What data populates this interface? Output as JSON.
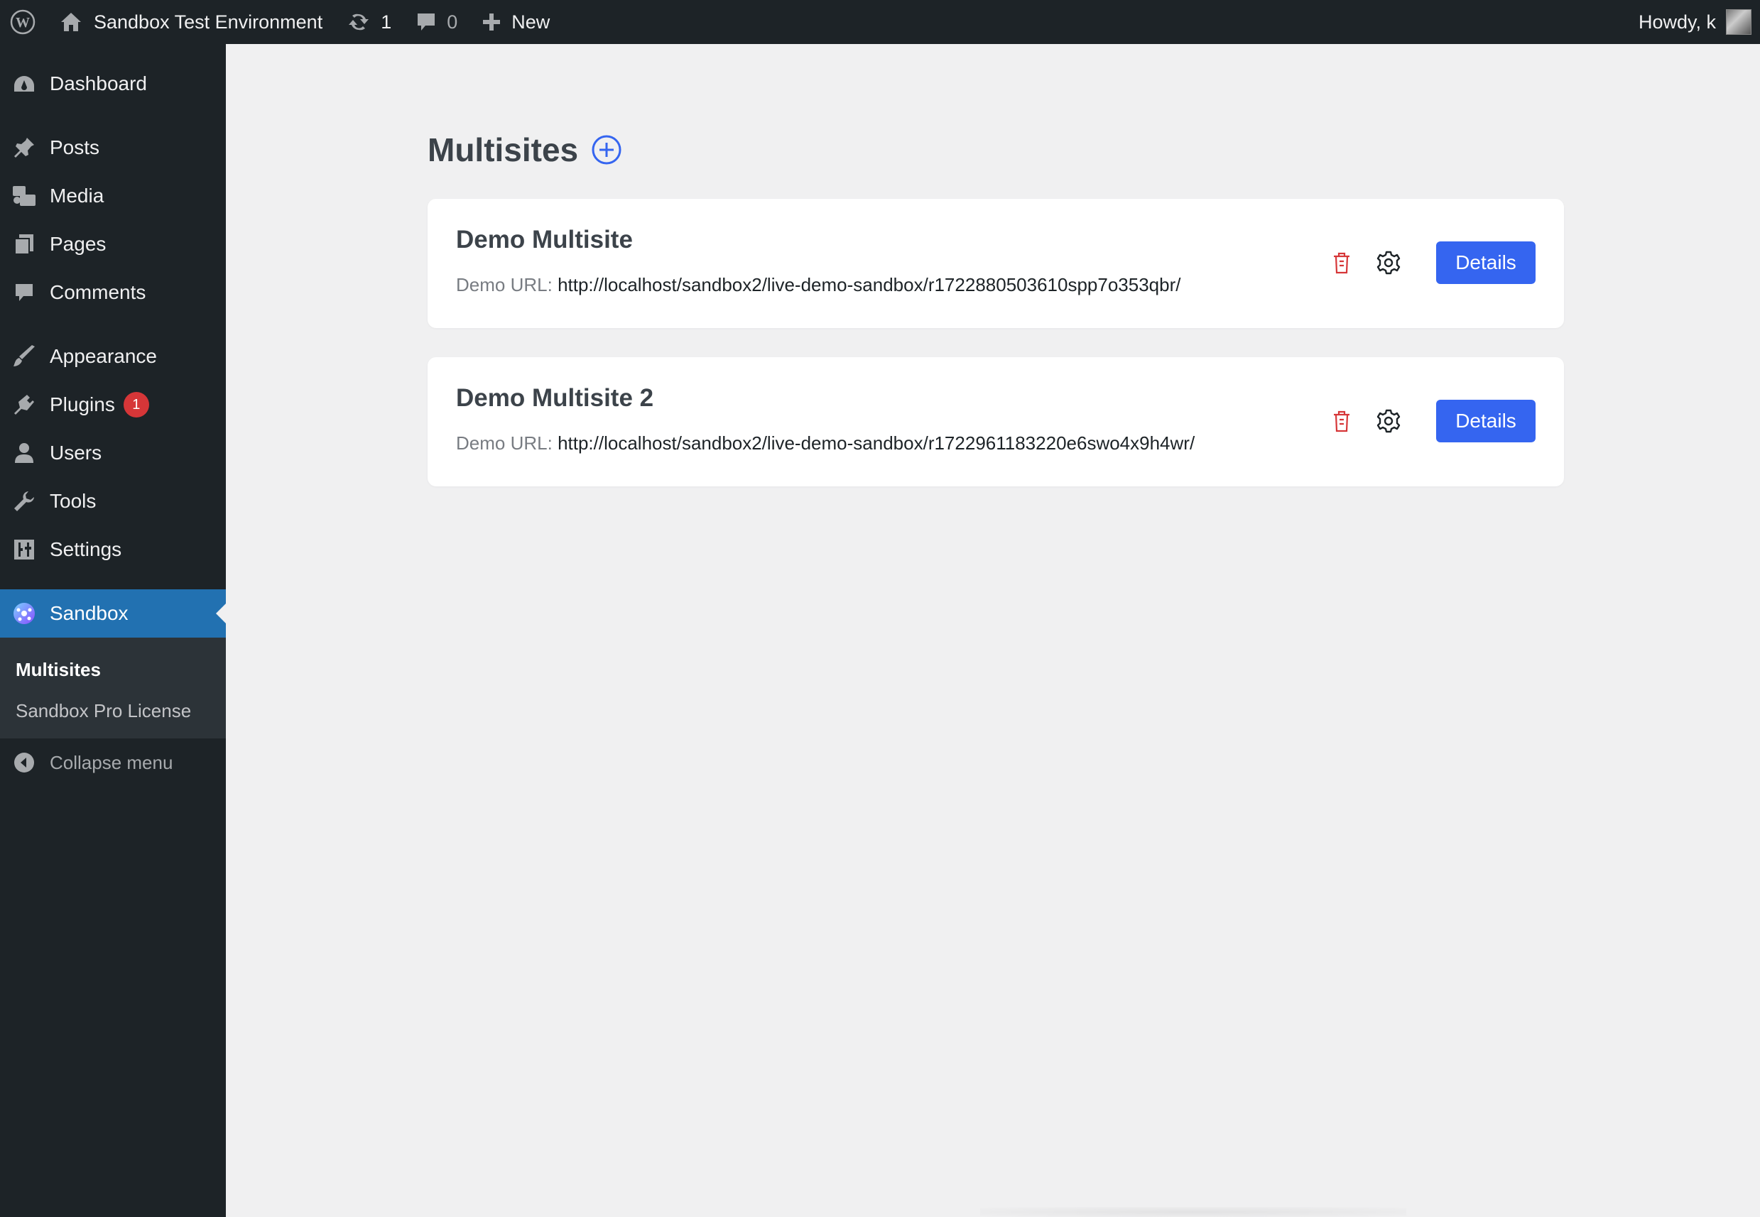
{
  "admin_bar": {
    "site_name": "Sandbox Test Environment",
    "updates_count": "1",
    "comments_count": "0",
    "new_label": "New",
    "greeting": "Howdy, k"
  },
  "sidebar": {
    "items": [
      {
        "label": "Dashboard",
        "icon": "dashboard-icon"
      },
      {
        "label": "Posts",
        "icon": "pin-icon"
      },
      {
        "label": "Media",
        "icon": "media-icon"
      },
      {
        "label": "Pages",
        "icon": "pages-icon"
      },
      {
        "label": "Comments",
        "icon": "comment-icon"
      },
      {
        "label": "Appearance",
        "icon": "brush-icon"
      },
      {
        "label": "Plugins",
        "icon": "plugin-icon",
        "badge": "1"
      },
      {
        "label": "Users",
        "icon": "user-icon"
      },
      {
        "label": "Tools",
        "icon": "wrench-icon"
      },
      {
        "label": "Settings",
        "icon": "settings-icon"
      },
      {
        "label": "Sandbox",
        "icon": "sandbox-icon"
      }
    ],
    "submenu": [
      "Multisites",
      "Sandbox Pro License"
    ],
    "collapse_label": "Collapse menu"
  },
  "main": {
    "title": "Multisites",
    "cards": [
      {
        "title": "Demo Multisite",
        "url_label": "Demo URL:",
        "url": "http://localhost/sandbox2/live-demo-sandbox/r1722880503610spp7o353qbr/",
        "details_label": "Details"
      },
      {
        "title": "Demo Multisite 2",
        "url_label": "Demo URL:",
        "url": "http://localhost/sandbox2/live-demo-sandbox/r1722961183220e6swo4x9h4wr/",
        "details_label": "Details"
      }
    ]
  },
  "colors": {
    "admin_bar_bg": "#1d2327",
    "accent_blue": "#3565f0",
    "current_menu": "#2271b1",
    "delete_red": "#d63638",
    "badge_red": "#d63638"
  }
}
